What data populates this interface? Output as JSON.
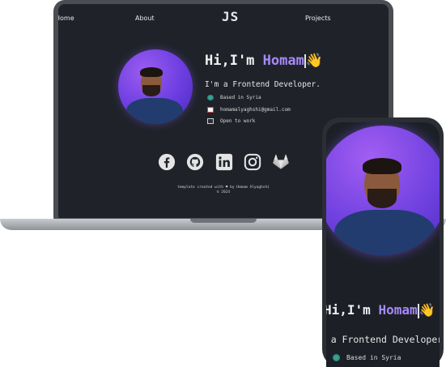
{
  "laptop": {
    "nav": {
      "home": "Home",
      "about": "About",
      "logo": "JS",
      "projects": "Projects"
    },
    "hero": {
      "greeting": "Hi,I'm ",
      "name": "Homam",
      "wave": "👋",
      "subtitle": "I'm a Frontend Developer."
    },
    "info": [
      {
        "icon": "globe-icon",
        "text": "Based in Syria"
      },
      {
        "icon": "mail-icon",
        "text": "homamalyaghshi@gmail.com"
      },
      {
        "icon": "laptop-icon",
        "text": "Open to work"
      }
    ],
    "socials": [
      "facebook-icon",
      "github-icon",
      "linkedin-icon",
      "instagram-icon",
      "gitlab-icon"
    ],
    "footer": {
      "credit": "template created with ♥ by Homam Alyaghshi",
      "year": "© 2024"
    }
  },
  "phone": {
    "hero": {
      "greeting": "Hi,I'm ",
      "name": "Homam",
      "wave": "👋",
      "subtitle": "I'm a Frontend Developer."
    },
    "info": [
      {
        "icon": "globe-icon",
        "text": "Based in Syria"
      }
    ]
  },
  "colors": {
    "accent": "#a889f8",
    "background": "#1f2329",
    "avatar_gradient": "#7a45e6"
  }
}
